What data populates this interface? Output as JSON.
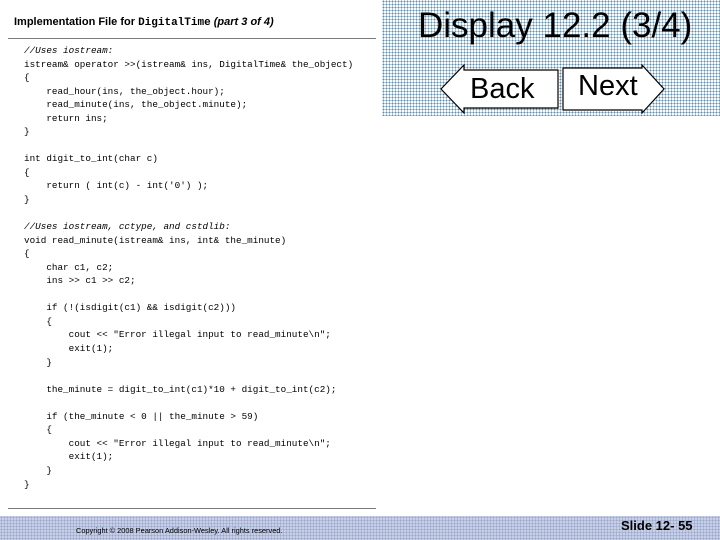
{
  "slide": {
    "title": "Display 12.2 (3/4)",
    "nav": {
      "back_label": "Back",
      "next_label": "Next"
    },
    "panel": {
      "title_prefix": "Implementation File for ",
      "title_class": "DigitalTime",
      "title_part": "(part 3 of 4)"
    },
    "code_lines": [
      "//Uses iostream:",
      "istream& operator >>(istream& ins, DigitalTime& the_object)",
      "{",
      "    read_hour(ins, the_object.hour);",
      "    read_minute(ins, the_object.minute);",
      "    return ins;",
      "}",
      "",
      "int digit_to_int(char c)",
      "{",
      "    return ( int(c) - int('0') );",
      "}",
      "",
      "//Uses iostream, cctype, and cstdlib:",
      "void read_minute(istream& ins, int& the_minute)",
      "{",
      "    char c1, c2;",
      "    ins >> c1 >> c2;",
      "",
      "    if (!(isdigit(c1) && isdigit(c2)))",
      "    {",
      "        cout << \"Error illegal input to read_minute\\n\";",
      "        exit(1);",
      "    }",
      "",
      "    the_minute = digit_to_int(c1)*10 + digit_to_int(c2);",
      "",
      "    if (the_minute < 0 || the_minute > 59)",
      "    {",
      "        cout << \"Error illegal input to read_minute\\n\";",
      "        exit(1);",
      "    }",
      "}"
    ],
    "footer": {
      "copyright": "Copyright © 2008 Pearson Addison-Wesley. All rights reserved.",
      "slide_number": "Slide 12- 55"
    }
  },
  "colors": {
    "header_dots": "#5f8fb0",
    "footer_band": "#c7cfe6",
    "arrow_fill": "#ffffff"
  },
  "icons": {
    "back": "left-arrow-icon",
    "next": "right-arrow-icon"
  }
}
